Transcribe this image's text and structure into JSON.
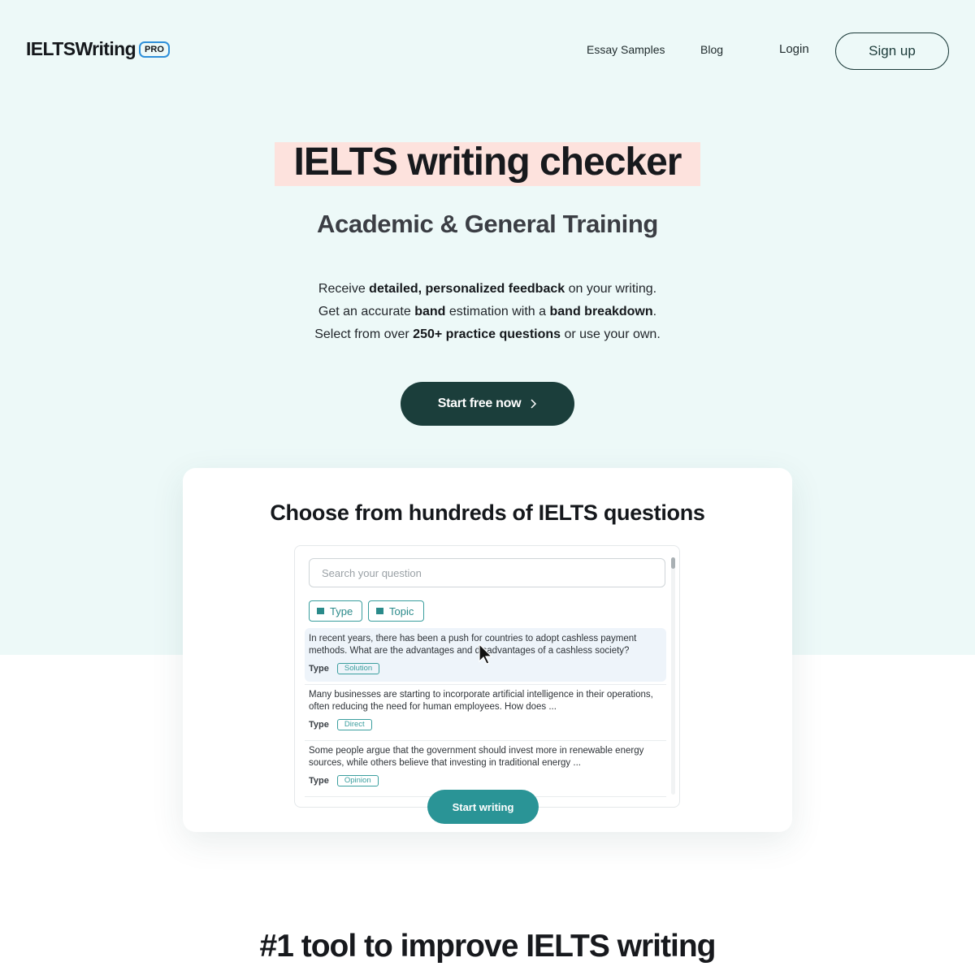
{
  "header": {
    "logo_text": "IELTSWriting",
    "logo_badge": "PRO",
    "nav": {
      "essay_samples": "Essay Samples",
      "blog": "Blog",
      "login": "Login",
      "signup": "Sign up"
    }
  },
  "hero": {
    "title": "IELTS writing checker",
    "subtitle": "Academic & General Training",
    "line1": {
      "pre": "Receive ",
      "bold": "detailed, personalized feedback",
      "post": " on your writing."
    },
    "line2": {
      "pre": "Get an accurate ",
      "bold1": "band",
      "mid": " estimation with a ",
      "bold2": "band breakdown",
      "post": "."
    },
    "line3": {
      "pre": "Select from over ",
      "bold": "250+ practice questions",
      "post": " or use your own."
    },
    "cta_label": "Start free now"
  },
  "card": {
    "title": "Choose from hundreds of IELTS questions",
    "search_placeholder": "Search your question",
    "filters": {
      "type": "Type",
      "topic": "Topic"
    },
    "questions": [
      {
        "text": "In recent years, there has been a push for countries to adopt cashless payment methods. What are the advantages and disadvantages of a cashless society?",
        "type_label": "Type",
        "type_value": "Solution"
      },
      {
        "text": "Many businesses are starting to incorporate artificial intelligence in their operations, often reducing the need for human employees. How does ...",
        "type_label": "Type",
        "type_value": "Direct"
      },
      {
        "text": "Some people argue that the government should invest more in renewable energy sources, while others believe that investing in traditional energy ...",
        "type_label": "Type",
        "type_value": "Opinion"
      }
    ],
    "start_writing": "Start writing"
  },
  "bottom": {
    "title": "#1 tool to improve IELTS writing"
  },
  "colors": {
    "hero_bg": "#edf9f8",
    "title_highlight": "#fde2dd",
    "cta_bg": "#1b3e3b",
    "accent_teal": "#2a9496",
    "badge_border": "#2e8fd9"
  }
}
